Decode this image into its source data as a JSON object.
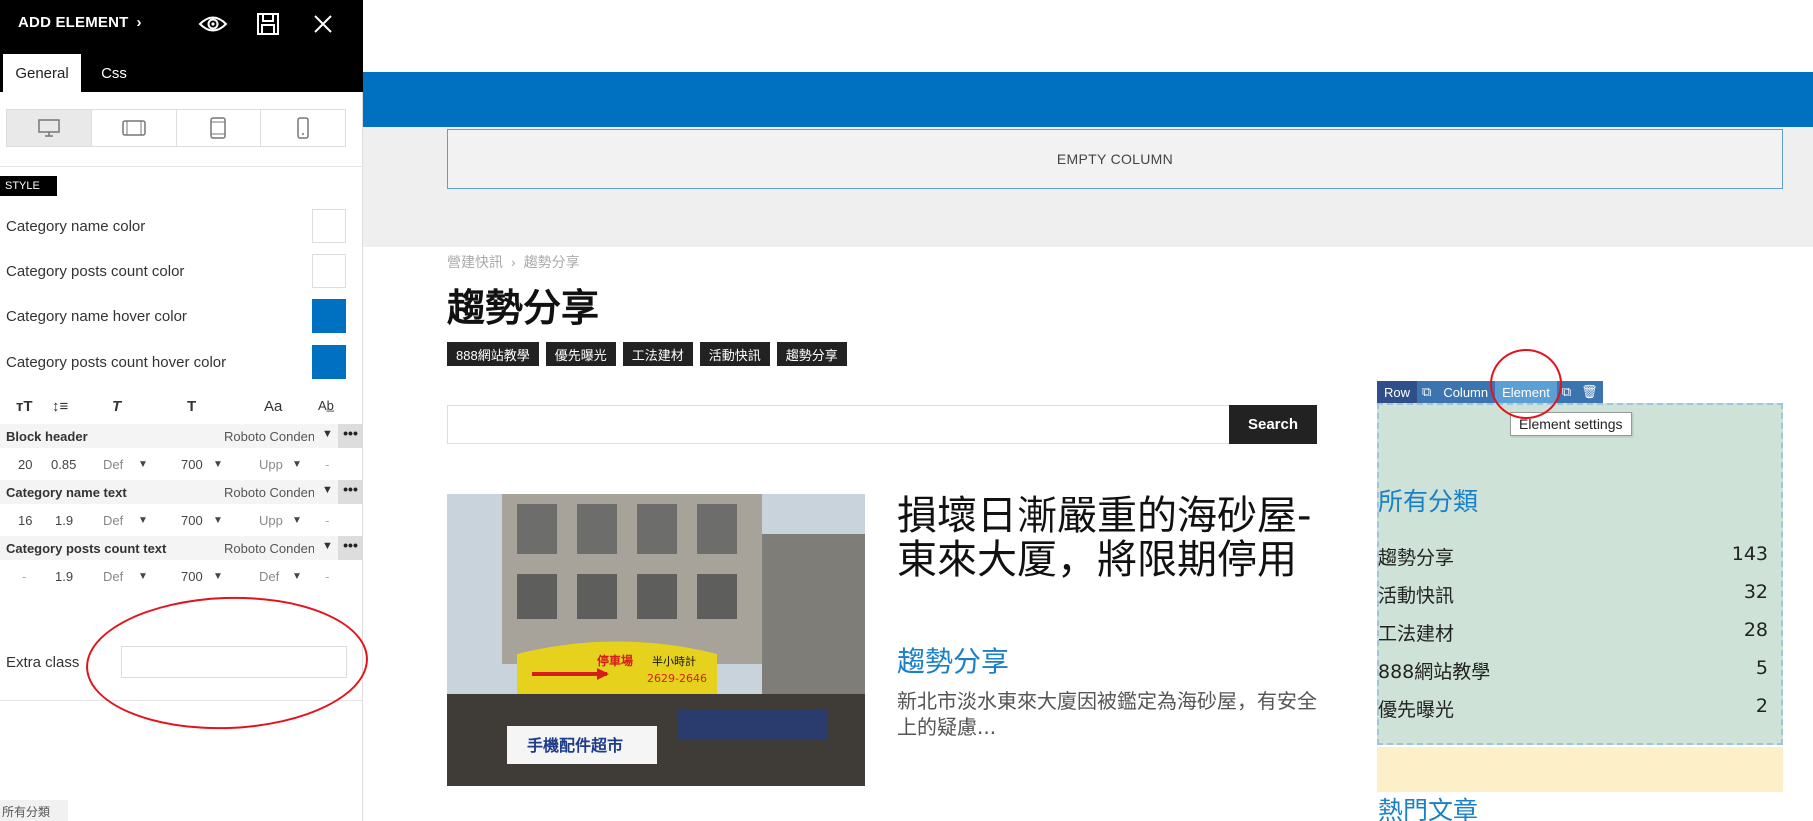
{
  "panel": {
    "title": "ADD ELEMENT",
    "chevron": "›",
    "icons": [
      "eye-icon",
      "save-icon",
      "close-icon"
    ],
    "tabs": [
      {
        "label": "General",
        "active": true
      },
      {
        "label": "Css",
        "active": false
      }
    ],
    "devices": [
      "desktop-icon",
      "tablet-landscape-icon",
      "tablet-portrait-icon",
      "mobile-icon"
    ],
    "style_label": "STYLE",
    "colors": [
      {
        "label": "Category name color",
        "value": "#ffffff"
      },
      {
        "label": "Category posts count color",
        "value": "#ffffff"
      },
      {
        "label": "Category name hover color",
        "value": "#0070c0"
      },
      {
        "label": "Category posts count hover color",
        "value": "#0070c0"
      }
    ],
    "typo_icons": [
      "font-size-icon",
      "line-height-icon",
      "font-style-icon",
      "font-weight-icon",
      "text-case-icon",
      "letter-spacing-icon"
    ],
    "typo_rows": [
      {
        "name": "Block header",
        "font": "Roboto Condensed",
        "size": "20",
        "line": "0.85",
        "style": "Def",
        "weight": "700",
        "transform": "Upp",
        "spacing": "-"
      },
      {
        "name": "Category name text",
        "font": "Roboto Condensed",
        "size": "16",
        "line": "1.9",
        "style": "Def",
        "weight": "700",
        "transform": "Upp",
        "spacing": "-"
      },
      {
        "name": "Category posts count text",
        "font": "Roboto Condensed",
        "size": "-",
        "line": "1.9",
        "style": "Def",
        "weight": "700",
        "transform": "Def",
        "spacing": "-"
      }
    ],
    "extra_class_label": "Extra class",
    "extra_class_value": "",
    "bottom_crumb": "所有分類"
  },
  "site": {
    "empty_column": "EMPTY COLUMN",
    "breadcrumb": [
      "營建快訊",
      "趨勢分享"
    ],
    "breadcrumb_sep": "›",
    "page_title": "趨勢分享",
    "tags": [
      "888網站教學",
      "優先曝光",
      "工法建材",
      "活動快訊",
      "趨勢分享"
    ],
    "search_placeholder": "",
    "search_button": "Search",
    "post": {
      "title": "損壞日漸嚴重的海砂屋-東來大厦，將限期停用",
      "category": "趨勢分享",
      "excerpt": "新北市淡水東來大廈因被鑑定為海砂屋，有安全上的疑慮..."
    },
    "sign_texts": {
      "parking": "停車場",
      "half_hour": "半小時計",
      "phone": "2629-2646",
      "shop": "手機配件超市"
    }
  },
  "widget": {
    "toolbar": [
      "Row",
      "Column",
      "Element"
    ],
    "tooltip": "Element settings",
    "title": "所有分類",
    "categories": [
      {
        "name": "趨勢分享",
        "count": "143"
      },
      {
        "name": "活動快訊",
        "count": "32"
      },
      {
        "name": "工法建材",
        "count": "28"
      },
      {
        "name": "888網站教學",
        "count": "5"
      },
      {
        "name": "優先曝光",
        "count": "2"
      }
    ],
    "next_title": "熱門文章"
  },
  "colors": {
    "brand_blue": "#0070c0",
    "link_blue": "#1a80c8",
    "widget_bg": "#cfe2d8",
    "annotation_red": "#e3121b"
  }
}
